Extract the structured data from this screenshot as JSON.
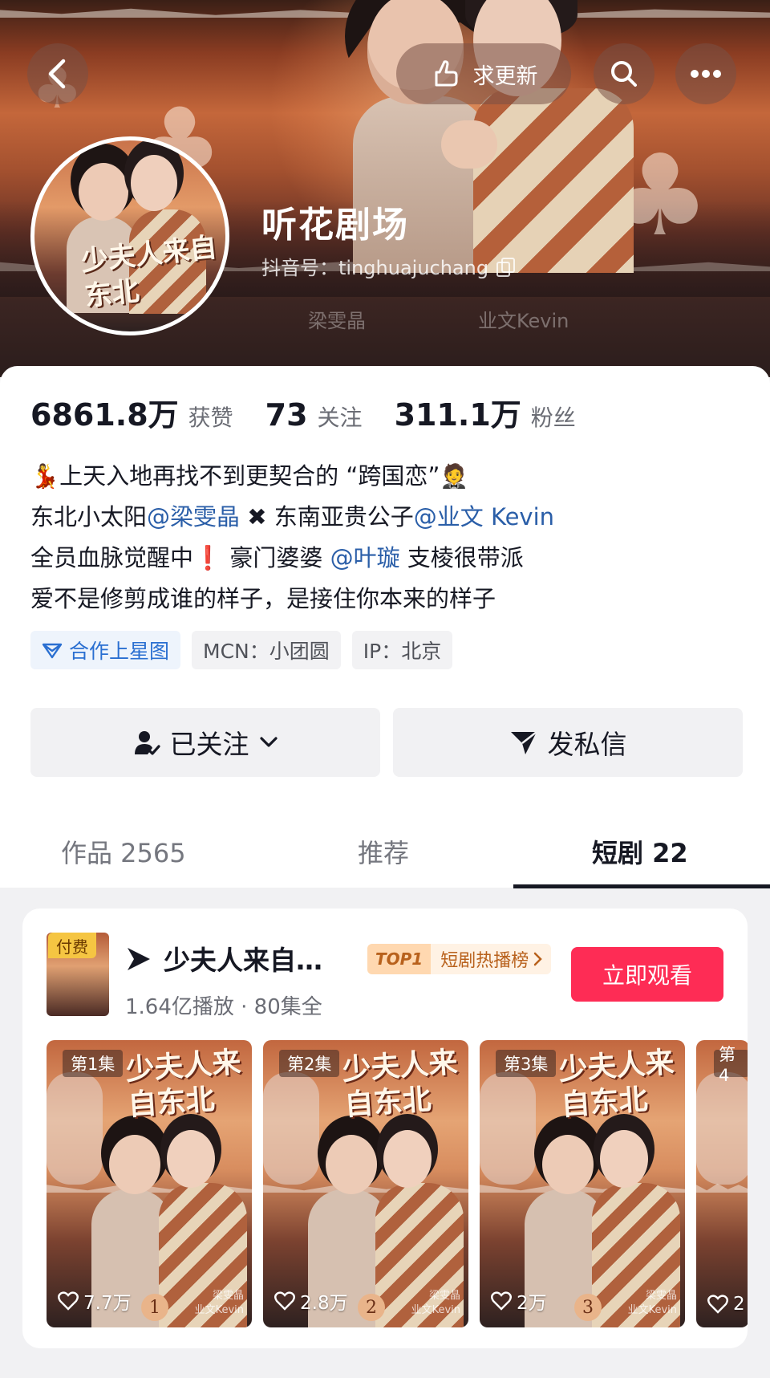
{
  "header": {
    "update_label": "求更新",
    "nickname": "听花剧场",
    "douyin_id": "抖音号：tinghuajuchang",
    "avatar_title": "少夫人来自东北",
    "cast": [
      "梁雯晶",
      "业文Kevin"
    ]
  },
  "stats": [
    {
      "value": "6861.8万",
      "label": "获赞"
    },
    {
      "value": "73",
      "label": "关注"
    },
    {
      "value": "311.1万",
      "label": "粉丝"
    }
  ],
  "bio": {
    "line1": {
      "emoji_start": "💃",
      "text": "上天入地再找不到更契合的 “跨国恋”",
      "emoji_end": "🤵"
    },
    "line2": {
      "text_a": "东北小太阳",
      "mention_a": "@梁雯晶",
      "cross": " ✖ ",
      "text_b": "东南亚贵公子",
      "mention_b": "@业文 Kevin"
    },
    "line3": {
      "text_a": "全员血脉觉醒中",
      "bang": "❗",
      "text_b": " 豪门婆婆",
      "mention": "@叶璇",
      "text_c": " 支棱很带派"
    },
    "line4": "爱不是修剪成谁的样子，是接住你本来的样子"
  },
  "tags": [
    {
      "label": "合作上星图"
    },
    {
      "label": "MCN：小团圆"
    },
    {
      "label": "IP：北京"
    }
  ],
  "actions": {
    "follow_label": "已关注",
    "message_label": "发私信"
  },
  "tabs": {
    "works": "作品 2565",
    "recommend": "推荐",
    "drama": "短剧 22"
  },
  "drama": {
    "paid_badge": "付费",
    "title": "少夫人来自…",
    "meta": "1.64亿播放 · 80集全",
    "rank_top": "TOP1",
    "rank_label": "短剧热播榜",
    "watch_label": "立即观看",
    "poster_title": "少夫人来自东北",
    "credit_line1": "梁雯晶",
    "credit_line2": "业文Kevin",
    "episodes": [
      {
        "label": "第1集",
        "likes": "7.7万",
        "number": "1"
      },
      {
        "label": "第2集",
        "likes": "2.8万",
        "number": "2"
      },
      {
        "label": "第3集",
        "likes": "2万",
        "number": "3"
      },
      {
        "label": "第4",
        "likes": "2"
      }
    ]
  },
  "colors": {
    "accent": "#fe2c55",
    "mention": "#2a5ea8",
    "rank_text": "#b8611c",
    "paid_badge": "#f5c542"
  }
}
